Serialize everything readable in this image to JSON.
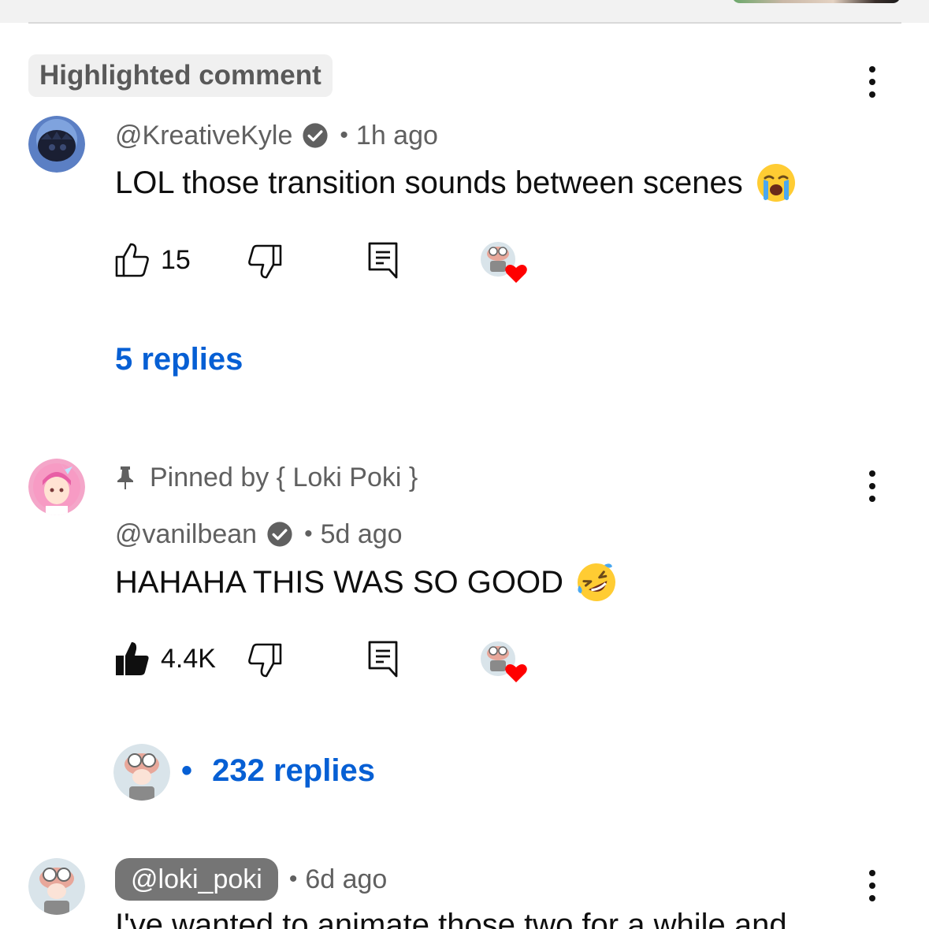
{
  "highlight_badge": "Highlighted comment",
  "comments": [
    {
      "handle": "@KreativeKyle",
      "verified": true,
      "time": "1h ago",
      "text": "LOL those transition sounds between scenes",
      "emoji": "loudly-crying-face",
      "likes": "15",
      "liked": false,
      "creator_hearted": true,
      "replies_label": "5 replies"
    },
    {
      "pinned_label": "Pinned by { Loki Poki }",
      "handle": "@vanilbean",
      "verified": true,
      "time": "5d ago",
      "text": "HAHAHA THIS WAS SO GOOD",
      "emoji": "rolling-on-floor-laughing-face",
      "likes": "4.4K",
      "liked": true,
      "creator_hearted": true,
      "replies_label": "232 replies",
      "replies_prefix": "•"
    },
    {
      "handle": "@loki_poki",
      "is_creator": true,
      "time": "6d ago",
      "text": "I've wanted to animate those two for a while and"
    }
  ],
  "separator_dot": "•",
  "colors": {
    "link": "#065fd4",
    "meta": "#606060",
    "heart": "#ff0000",
    "creator_chip": "#757575"
  }
}
